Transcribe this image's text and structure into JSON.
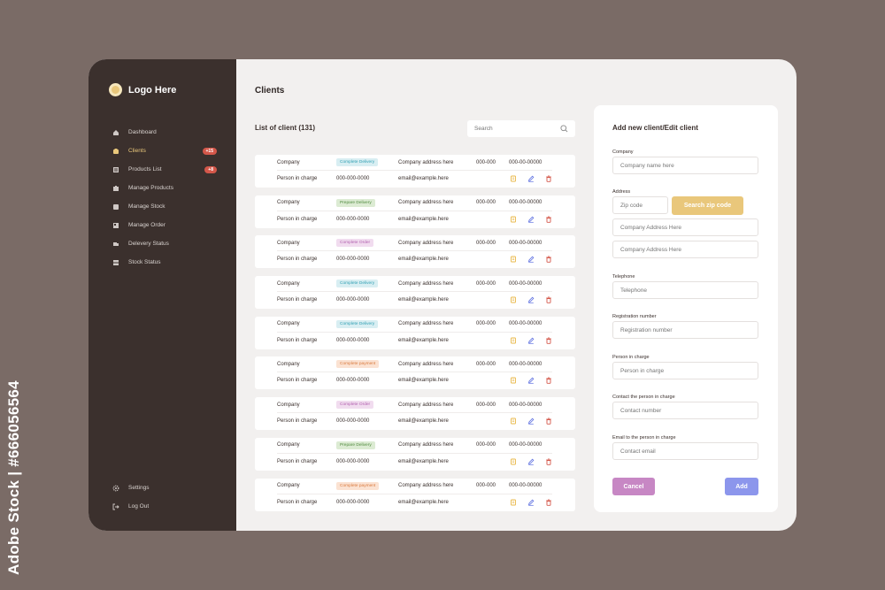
{
  "watermark": "Adobe Stock | #666056564",
  "logo": {
    "text": "Logo Here"
  },
  "nav": {
    "items": [
      {
        "label": "Dashboard",
        "icon": "home-icon"
      },
      {
        "label": "Clients",
        "icon": "clients-icon",
        "badge": "+15",
        "active": true
      },
      {
        "label": "Products List",
        "icon": "products-list-icon",
        "badge": "+8"
      },
      {
        "label": "Manage Products",
        "icon": "manage-products-icon"
      },
      {
        "label": "Manage Stock",
        "icon": "manage-stock-icon"
      },
      {
        "label": "Manage Order",
        "icon": "manage-order-icon"
      },
      {
        "label": "Delevery Status",
        "icon": "delivery-status-icon"
      },
      {
        "label": "Stock Status",
        "icon": "stock-status-icon"
      }
    ],
    "bottom": [
      {
        "label": "Settings",
        "icon": "gear-icon"
      },
      {
        "label": "Log Out",
        "icon": "logout-icon"
      }
    ]
  },
  "main": {
    "title": "Clients",
    "list_title": "List of client (131)",
    "search_placeholder": "Search"
  },
  "clients": [
    {
      "company": "Company",
      "status": "Complete Delivery",
      "status_color": "#2f9fb3",
      "status_bg": "#d8eef2",
      "address": "Company address here",
      "zip": "000-000",
      "tel": "000-00-00000",
      "person": "Person in charge",
      "phone": "000-000-0000",
      "email": "email@example.here"
    },
    {
      "company": "Company",
      "status": "Prepare Delivery",
      "status_color": "#4f8a3e",
      "status_bg": "#dcebd3",
      "address": "Company address here",
      "zip": "000-000",
      "tel": "000-00-00000",
      "person": "Person in charge",
      "phone": "000-000-0000",
      "email": "email@example.here"
    },
    {
      "company": "Company",
      "status": "Complete Order",
      "status_color": "#b05fae",
      "status_bg": "#f1dcef",
      "address": "Company address here",
      "zip": "000-000",
      "tel": "000-00-00000",
      "person": "Person in charge",
      "phone": "000-000-0000",
      "email": "email@example.here"
    },
    {
      "company": "Company",
      "status": "Complete Delivery",
      "status_color": "#2f9fb3",
      "status_bg": "#d8eef2",
      "address": "Company address here",
      "zip": "000-000",
      "tel": "000-00-00000",
      "person": "Person in charge",
      "phone": "000-000-0000",
      "email": "email@example.here"
    },
    {
      "company": "Company",
      "status": "Complete Delivery",
      "status_color": "#2f9fb3",
      "status_bg": "#d8eef2",
      "address": "Company address here",
      "zip": "000-000",
      "tel": "000-00-00000",
      "person": "Person in charge",
      "phone": "000-000-0000",
      "email": "email@example.here"
    },
    {
      "company": "Company",
      "status": "Complete payment",
      "status_color": "#d97a3e",
      "status_bg": "#fbe2d2",
      "address": "Company address here",
      "zip": "000-000",
      "tel": "000-00-00000",
      "person": "Person in charge",
      "phone": "000-000-0000",
      "email": "email@example.here"
    },
    {
      "company": "Company",
      "status": "Complete Order",
      "status_color": "#b05fae",
      "status_bg": "#f1dcef",
      "address": "Company address here",
      "zip": "000-000",
      "tel": "000-00-00000",
      "person": "Person in charge",
      "phone": "000-000-0000",
      "email": "email@example.here"
    },
    {
      "company": "Company",
      "status": "Prepare Delivery",
      "status_color": "#4f8a3e",
      "status_bg": "#dcebd3",
      "address": "Company address here",
      "zip": "000-000",
      "tel": "000-00-00000",
      "person": "Person in charge",
      "phone": "000-000-0000",
      "email": "email@example.here"
    },
    {
      "company": "Company",
      "status": "Complete payment",
      "status_color": "#d97a3e",
      "status_bg": "#fbe2d2",
      "address": "Company address here",
      "zip": "000-000",
      "tel": "000-00-00000",
      "person": "Person in charge",
      "phone": "000-000-0000",
      "email": "email@example.here"
    }
  ],
  "colors": {
    "action_view": "#e9b94a",
    "action_edit": "#5d6fe0",
    "action_delete": "#d4574a"
  },
  "form": {
    "title": "Add new client/Edit client",
    "company_label": "Company",
    "company_placeholder": "Company name here",
    "address_label": "Address",
    "zip_placeholder": "Zip code",
    "zip_button": "Search zip code",
    "address1_placeholder": "Company Address Here",
    "address2_placeholder": "Company Address Here",
    "telephone_label": "Telephone",
    "telephone_placeholder": "Telephone",
    "registration_label": "Registration number",
    "registration_placeholder": "Registration number",
    "person_label": "Person in charge",
    "person_placeholder": "Person in charge",
    "contact_label": "Contact the person in charge",
    "contact_placeholder": "Contact number",
    "email_label": "Email to the person in charge",
    "email_placeholder": "Contact email",
    "cancel_label": "Cancel",
    "add_label": "Add"
  }
}
